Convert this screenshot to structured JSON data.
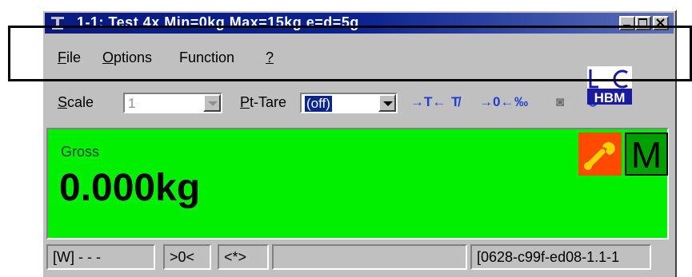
{
  "window": {
    "title": "1-1: Test 4x Min=0kg Max=15kg e=d=5g"
  },
  "menu": [
    {
      "first": "F",
      "rest": "ile"
    },
    {
      "first": "O",
      "rest": "ptions"
    },
    {
      "first": "",
      "rest": "Function"
    },
    {
      "first": "?",
      "rest": ""
    }
  ],
  "toolbar": {
    "scale_label_u": "S",
    "scale_label_rest": "cale",
    "scale_value": "1",
    "pttare_label_u": "P",
    "pttare_label_rest": "t-Tare",
    "pttare_value": "(off)",
    "tool_icons": [
      "tare-icon",
      "clear-tare-icon",
      "zero-icon",
      "permille-icon",
      "camera-icon",
      "print-icon"
    ],
    "tool_glyphs": [
      "→T←",
      "T̸",
      "→0←",
      "‰",
      "◙",
      "⊙"
    ],
    "logo_text": "HBM"
  },
  "display": {
    "mode_label": "Gross",
    "weight": "0.000kg",
    "m_badge": "M",
    "colors": {
      "background": "#00f000",
      "wrench": "#ff4a00",
      "m_badge": "#00a000"
    }
  },
  "statusbar": {
    "mode": "[W] - - -",
    "zero": ">0<",
    "stable": "<*>",
    "empty": "",
    "id": "[0628-c99f-ed08-1.1-1"
  }
}
